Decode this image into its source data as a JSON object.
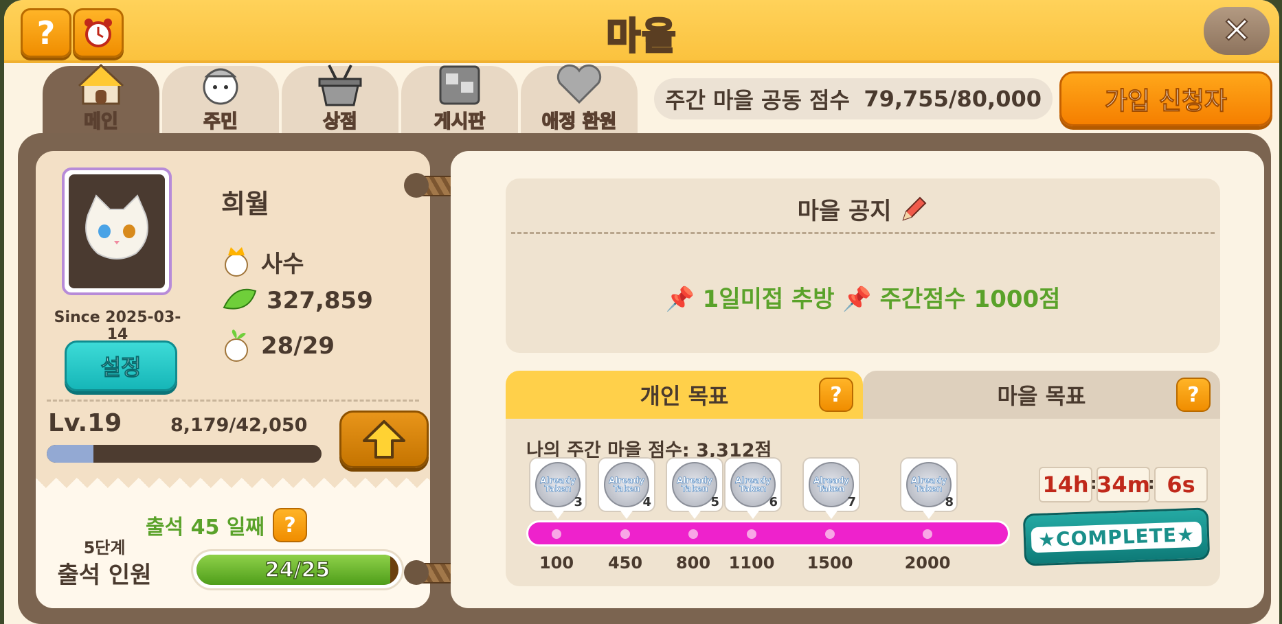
{
  "header": {
    "title": "마을",
    "help_label": "?",
    "close_label": "✕"
  },
  "tabs": [
    {
      "label": "메인",
      "icon": "house-icon",
      "active": true
    },
    {
      "label": "주민",
      "icon": "villager-icon",
      "active": false
    },
    {
      "label": "상점",
      "icon": "basket-icon",
      "active": false
    },
    {
      "label": "게시판",
      "icon": "board-icon",
      "active": false
    },
    {
      "label": "애정 환원",
      "icon": "heart-icon",
      "active": false
    }
  ],
  "weekly": {
    "label": "주간 마을 공동 점수",
    "value": "79,755/80,000"
  },
  "apply_button": "가입 신청자",
  "profile": {
    "name": "희월",
    "since": "Since 2025-03-14",
    "settings_label": "설정",
    "role": "사수",
    "leaves": "327,859",
    "members": "28/29",
    "level": "Lv.19",
    "exp": "8,179/42,050",
    "exp_progress": 0.17
  },
  "attendance": {
    "days_label": "출석 45 일째",
    "stage": "5단계",
    "label": "출석 인원",
    "value": "24/25",
    "progress": 0.96
  },
  "notice": {
    "title": "마을 공지",
    "text": "📌 1일미접 추방 📌 주간점수 1000점"
  },
  "goals": {
    "personal_tab": "개인 목표",
    "village_tab": "마을 목표",
    "my_score": "나의 주간 마을 점수: 3,312점",
    "milestones": [
      {
        "value": "100",
        "num": "3",
        "badge": "Already Taken"
      },
      {
        "value": "450",
        "num": "4",
        "badge": "Already Taken"
      },
      {
        "value": "800",
        "num": "5",
        "badge": "Already Taken"
      },
      {
        "value": "1100",
        "num": "6",
        "badge": "Already Taken"
      },
      {
        "value": "1500",
        "num": "7",
        "badge": "Already Taken"
      },
      {
        "value": "2000",
        "num": "8",
        "badge": "Already Taken"
      }
    ],
    "timer": {
      "h": "14h",
      "m": "34m",
      "s": "6s"
    },
    "complete": "★COMPLETE★"
  },
  "colors": {
    "accent": "#fbc23e",
    "board": "#7b6450",
    "track": "#ee22cc",
    "green": "#5aa22a"
  }
}
